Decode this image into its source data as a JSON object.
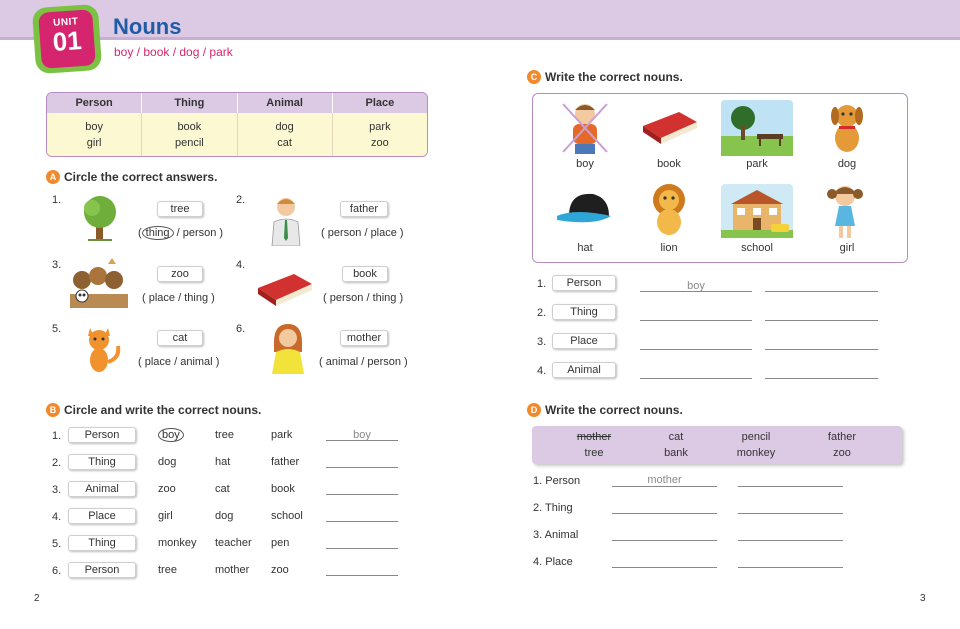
{
  "unit": {
    "label": "UNIT",
    "number": "01"
  },
  "title": "Nouns",
  "subtitle": "boy / book / dog / park",
  "categories": {
    "headers": [
      "Person",
      "Thing",
      "Animal",
      "Place"
    ],
    "columns": [
      [
        "boy",
        "girl"
      ],
      [
        "book",
        "pencil"
      ],
      [
        "dog",
        "cat"
      ],
      [
        "park",
        "zoo"
      ]
    ]
  },
  "section_a": {
    "letter": "A",
    "title": "Circle the correct answers.",
    "items": [
      {
        "n": "1.",
        "word": "tree",
        "open": "(",
        "opt1": "thing",
        "sep": "/",
        "opt2": "person",
        "close": ")"
      },
      {
        "n": "2.",
        "word": "father",
        "open": "(",
        "opt1": "person",
        "sep": "/",
        "opt2": "place",
        "close": ")"
      },
      {
        "n": "3.",
        "word": "zoo",
        "open": "(",
        "opt1": "place",
        "sep": "/",
        "opt2": "thing",
        "close": ")"
      },
      {
        "n": "4.",
        "word": "book",
        "open": "(",
        "opt1": "person",
        "sep": "/",
        "opt2": "thing",
        "close": ")"
      },
      {
        "n": "5.",
        "word": "cat",
        "open": "(",
        "opt1": "place",
        "sep": "/",
        "opt2": "animal",
        "close": ")"
      },
      {
        "n": "6.",
        "word": "mother",
        "open": "(",
        "opt1": "animal",
        "sep": "/",
        "opt2": "person",
        "close": ")"
      }
    ]
  },
  "section_b": {
    "letter": "B",
    "title": "Circle and write the correct nouns.",
    "rows": [
      {
        "n": "1.",
        "cat": "Person",
        "w1": "boy",
        "w2": "tree",
        "w3": "park",
        "answer": "boy"
      },
      {
        "n": "2.",
        "cat": "Thing",
        "w1": "dog",
        "w2": "hat",
        "w3": "father",
        "answer": ""
      },
      {
        "n": "3.",
        "cat": "Animal",
        "w1": "zoo",
        "w2": "cat",
        "w3": "book",
        "answer": ""
      },
      {
        "n": "4.",
        "cat": "Place",
        "w1": "girl",
        "w2": "dog",
        "w3": "school",
        "answer": ""
      },
      {
        "n": "5.",
        "cat": "Thing",
        "w1": "monkey",
        "w2": "teacher",
        "w3": "pen",
        "answer": ""
      },
      {
        "n": "6.",
        "cat": "Person",
        "w1": "tree",
        "w2": "mother",
        "w3": "zoo",
        "answer": ""
      }
    ]
  },
  "section_c": {
    "letter": "C",
    "title": "Write the correct nouns.",
    "pictures": [
      "boy",
      "book",
      "park",
      "dog",
      "hat",
      "lion",
      "school",
      "girl"
    ],
    "rows": [
      {
        "n": "1.",
        "cat": "Person",
        "answer": "boy"
      },
      {
        "n": "2.",
        "cat": "Thing",
        "answer": ""
      },
      {
        "n": "3.",
        "cat": "Place",
        "answer": ""
      },
      {
        "n": "4.",
        "cat": "Animal",
        "answer": ""
      }
    ]
  },
  "section_d": {
    "letter": "D",
    "title": "Write the correct nouns.",
    "words_top": [
      "mother",
      "cat",
      "pencil",
      "father"
    ],
    "words_bottom": [
      "tree",
      "bank",
      "monkey",
      "zoo"
    ],
    "rows": [
      {
        "n": "1.",
        "cat": "Person",
        "answer": "mother"
      },
      {
        "n": "2.",
        "cat": "Thing",
        "answer": ""
      },
      {
        "n": "3.",
        "cat": "Animal",
        "answer": ""
      },
      {
        "n": "4.",
        "cat": "Place",
        "answer": ""
      }
    ]
  },
  "pages": {
    "left": "2",
    "right": "3"
  }
}
